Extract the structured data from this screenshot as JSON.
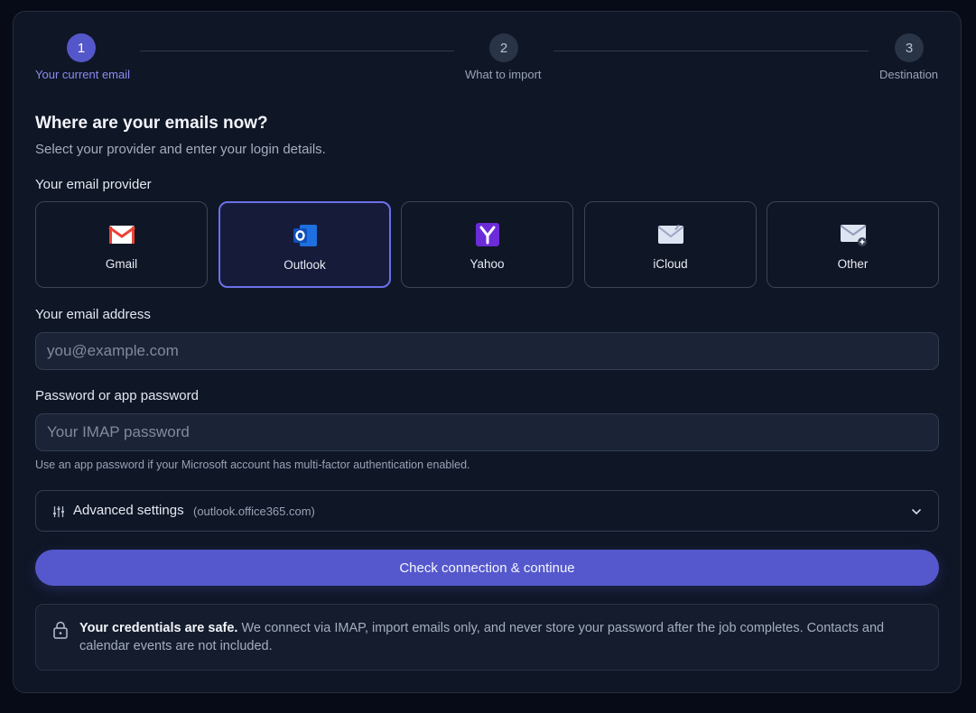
{
  "stepper": {
    "steps": [
      {
        "number": "1",
        "label": "Your current email",
        "state": "active"
      },
      {
        "number": "2",
        "label": "What to import",
        "state": "upcoming"
      },
      {
        "number": "3",
        "label": "Destination",
        "state": "upcoming"
      }
    ]
  },
  "header": {
    "title": "Where are your emails now?",
    "subtitle": "Select your provider and enter your login details."
  },
  "provider": {
    "label": "Your email provider",
    "selected": "Outlook",
    "options": [
      {
        "label": "Gmail",
        "icon": "gmail-icon"
      },
      {
        "label": "Outlook",
        "icon": "outlook-icon"
      },
      {
        "label": "Yahoo",
        "icon": "yahoo-icon"
      },
      {
        "label": "iCloud",
        "icon": "icloud-mail-icon"
      },
      {
        "label": "Other",
        "icon": "other-mail-icon"
      }
    ]
  },
  "email": {
    "label": "Your email address",
    "placeholder": "you@example.com",
    "value": ""
  },
  "password": {
    "label": "Password or app password",
    "placeholder": "Your IMAP password",
    "value": "",
    "hint": "Use an app password if your Microsoft account has multi-factor authentication enabled."
  },
  "advanced": {
    "label": "Advanced settings",
    "host": "(outlook.office365.com)",
    "icon": "sliders-icon",
    "expanded": false
  },
  "submit": {
    "label": "Check connection & continue"
  },
  "notice": {
    "bold": "Your credentials are safe.",
    "text": " We connect via IMAP, import emails only, and never store your password after the job completes. Contacts and calendar events are not included."
  },
  "colors": {
    "accent": "#5558cc",
    "background": "#070b17",
    "card": "#0f1626",
    "gmail_red": "#ea4335",
    "outlook_blue": "#1f6fe0",
    "yahoo_purple": "#6b2bd9"
  }
}
